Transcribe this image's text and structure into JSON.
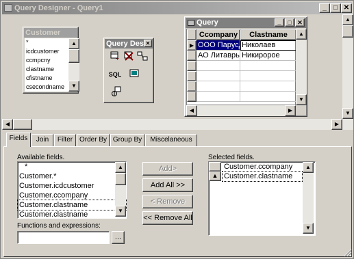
{
  "window": {
    "title": "Query Designer - Query1",
    "min_glyph": "_",
    "max_glyph": "□",
    "close_glyph": "✕"
  },
  "customer_table": {
    "title": "Customer",
    "fields": [
      "*",
      "icdcustomer",
      "ccmpcny",
      "clastname",
      "cfistname",
      "csecondname"
    ]
  },
  "toolbox": {
    "title": "Query Desi",
    "close_glyph": "✕",
    "sql_label": "SQL"
  },
  "query_window": {
    "title": "Query",
    "columns": [
      "Ccompany",
      "Clastname"
    ],
    "rows": [
      {
        "marker": "▶",
        "company": "ООО Парусд",
        "lastname": "Николаев"
      },
      {
        "marker": "",
        "company": "АО Литаврь",
        "lastname": "Никиророе"
      }
    ],
    "min_glyph": "_",
    "max_glyph": "□",
    "close_glyph": "✕"
  },
  "tabs": [
    "Fields",
    "Join",
    "Filter",
    "Order By",
    "Group By",
    "Miscelaneous"
  ],
  "available": {
    "label": "Available fields.",
    "items": [
      "*",
      "Customer.*",
      "Customer.icdcustomer",
      "Customer.ccompany",
      "Customer.clastname",
      "Customer.clastname"
    ]
  },
  "buttons": {
    "add": "Add>",
    "add_all": "Add All >>",
    "remove": "< Remove",
    "remove_all": "<< Remove All",
    "browse": "..."
  },
  "functions": {
    "label": "Functions and expressions:",
    "value": ""
  },
  "selected": {
    "label": "Selected fields.",
    "items": [
      "Customer.ccompany",
      "Customer.clastname"
    ]
  },
  "arrows": {
    "up": "▲",
    "down": "▼",
    "left": "◀",
    "right": "▶"
  },
  "colors": {
    "title_grad_start": "#808080",
    "title_grad_end": "#c0c0c0",
    "selection": "#000080",
    "window_bg": "#d4d0c8"
  }
}
